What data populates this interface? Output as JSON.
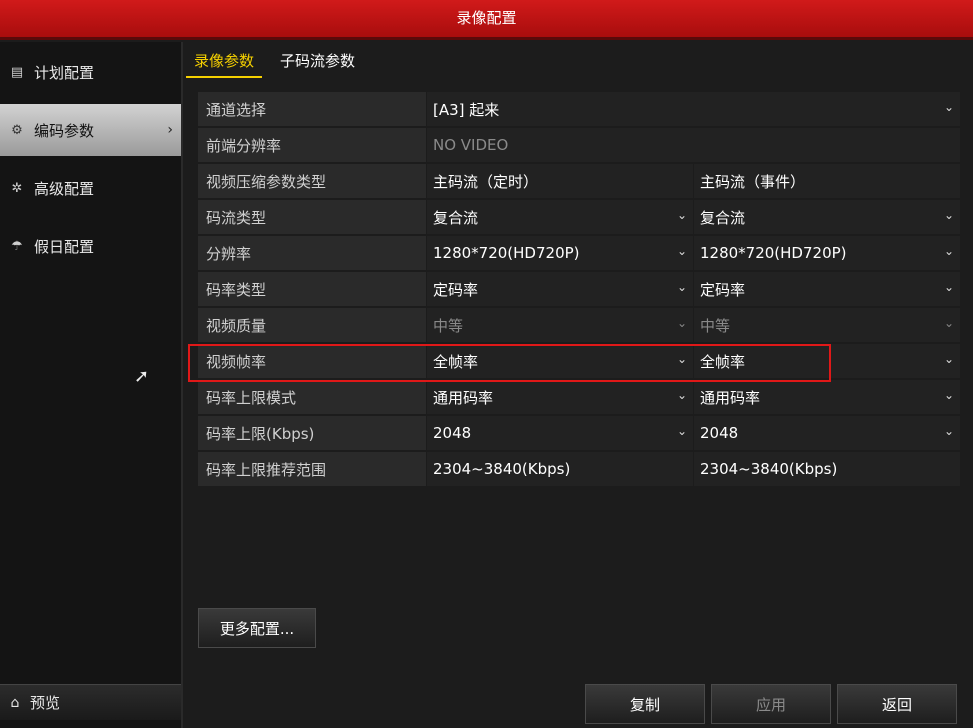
{
  "window": {
    "title": "录像配置"
  },
  "sidebar": {
    "items": [
      {
        "label": "计划配置",
        "icon": "schedule-icon"
      },
      {
        "label": "编码参数",
        "icon": "gear-icon",
        "active": true
      },
      {
        "label": "高级配置",
        "icon": "advanced-gear-icon"
      },
      {
        "label": "假日配置",
        "icon": "umbrella-icon"
      }
    ],
    "preview_label": "预览"
  },
  "tabs": [
    {
      "label": "录像参数",
      "active": true
    },
    {
      "label": "子码流参数"
    }
  ],
  "rows": [
    {
      "label": "通道选择",
      "value": "[A3] 起来"
    },
    {
      "label": "前端分辨率",
      "value": "NO VIDEO"
    },
    {
      "label": "视频压缩参数类型",
      "v1": "主码流（定时）",
      "v2": "主码流（事件）"
    },
    {
      "label": "码流类型",
      "v1": "复合流",
      "v2": "复合流"
    },
    {
      "label": "分辨率",
      "v1": "1280*720(HD720P)",
      "v2": "1280*720(HD720P)"
    },
    {
      "label": "码率类型",
      "v1": "定码率",
      "v2": "定码率"
    },
    {
      "label": "视频质量",
      "v1": "中等",
      "v2": "中等"
    },
    {
      "label": "视频帧率",
      "v1": "全帧率",
      "v2": "全帧率"
    },
    {
      "label": "码率上限模式",
      "v1": "通用码率",
      "v2": "通用码率"
    },
    {
      "label": "码率上限(Kbps)",
      "v1": "2048",
      "v2": "2048"
    },
    {
      "label": "码率上限推荐范围",
      "v1": "2304~3840(Kbps)",
      "v2": "2304~3840(Kbps)"
    }
  ],
  "buttons": {
    "more": "更多配置...",
    "copy": "复制",
    "apply": "应用",
    "back": "返回"
  },
  "colors": {
    "title_bar": "#c41414",
    "tab_active": "#f5d000",
    "highlight_border": "#e01818"
  }
}
